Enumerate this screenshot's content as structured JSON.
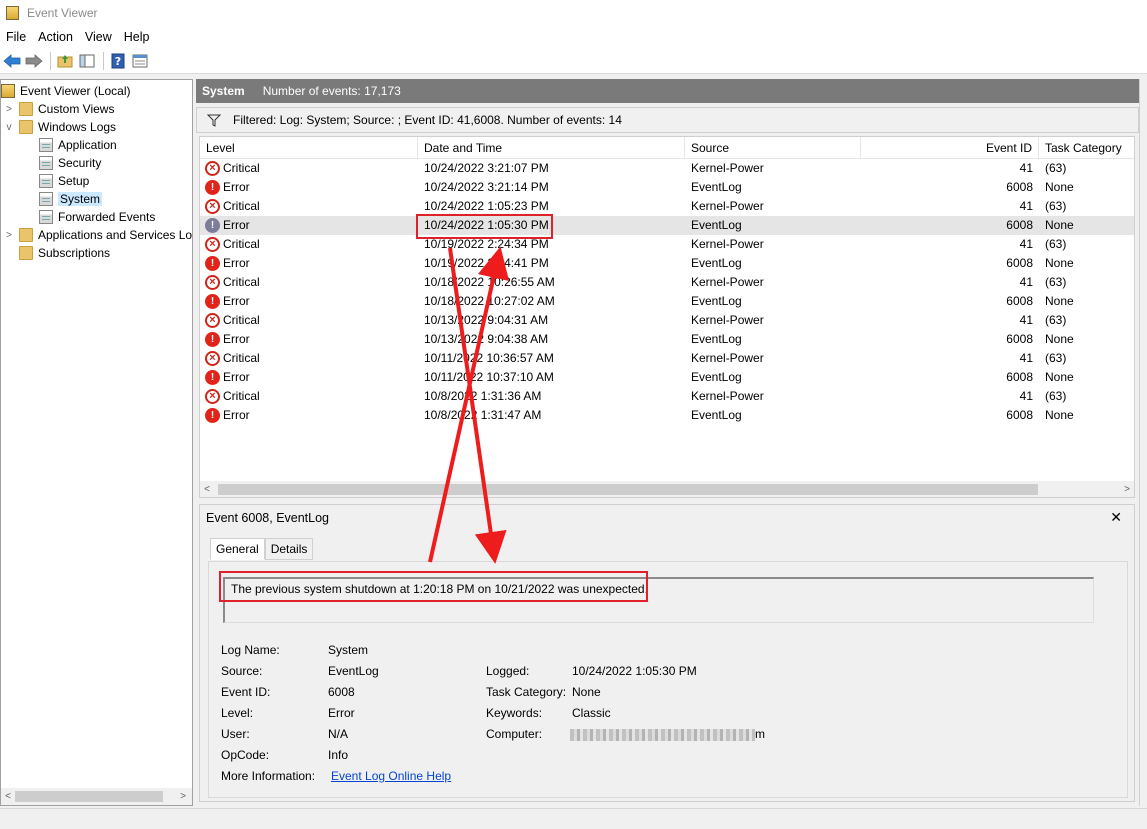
{
  "window": {
    "title": "Event Viewer"
  },
  "menu": [
    "File",
    "Action",
    "View",
    "Help"
  ],
  "toolbar": [
    "back-icon",
    "forward-icon",
    "up-folder-icon",
    "show-hide-tree-icon",
    "help-icon",
    "properties-icon"
  ],
  "tree": {
    "root": "Event Viewer (Local)",
    "custom_views": "Custom Views",
    "windows_logs": "Windows Logs",
    "logs": [
      "Application",
      "Security",
      "Setup",
      "System",
      "Forwarded Events"
    ],
    "apps_services": "Applications and Services Lo",
    "subscriptions": "Subscriptions"
  },
  "header": {
    "log_name": "System",
    "count_text": "Number of events: 17,173"
  },
  "filter": {
    "text": "Filtered: Log: System; Source: ; Event ID: 41,6008. Number of events: 14"
  },
  "columns": {
    "level": "Level",
    "datetime": "Date and Time",
    "source": "Source",
    "event_id": "Event ID",
    "task_category": "Task Category"
  },
  "events": [
    {
      "level": "Critical",
      "datetime": "10/24/2022 3:21:07 PM",
      "source": "Kernel-Power",
      "event_id": "41",
      "task": "(63)"
    },
    {
      "level": "Error",
      "datetime": "10/24/2022 3:21:14 PM",
      "source": "EventLog",
      "event_id": "6008",
      "task": "None"
    },
    {
      "level": "Critical",
      "datetime": "10/24/2022 1:05:23 PM",
      "source": "Kernel-Power",
      "event_id": "41",
      "task": "(63)"
    },
    {
      "level": "Error",
      "datetime": "10/24/2022 1:05:30 PM",
      "source": "EventLog",
      "event_id": "6008",
      "task": "None"
    },
    {
      "level": "Critical",
      "datetime": "10/19/2022 2:24:34 PM",
      "source": "Kernel-Power",
      "event_id": "41",
      "task": "(63)"
    },
    {
      "level": "Error",
      "datetime": "10/19/2022 2:24:41 PM",
      "source": "EventLog",
      "event_id": "6008",
      "task": "None"
    },
    {
      "level": "Critical",
      "datetime": "10/18/2022 10:26:55 AM",
      "source": "Kernel-Power",
      "event_id": "41",
      "task": "(63)"
    },
    {
      "level": "Error",
      "datetime": "10/18/2022 10:27:02 AM",
      "source": "EventLog",
      "event_id": "6008",
      "task": "None"
    },
    {
      "level": "Critical",
      "datetime": "10/13/2022 9:04:31 AM",
      "source": "Kernel-Power",
      "event_id": "41",
      "task": "(63)"
    },
    {
      "level": "Error",
      "datetime": "10/13/2022 9:04:38 AM",
      "source": "EventLog",
      "event_id": "6008",
      "task": "None"
    },
    {
      "level": "Critical",
      "datetime": "10/11/2022 10:36:57 AM",
      "source": "Kernel-Power",
      "event_id": "41",
      "task": "(63)"
    },
    {
      "level": "Error",
      "datetime": "10/11/2022 10:37:10 AM",
      "source": "EventLog",
      "event_id": "6008",
      "task": "None"
    },
    {
      "level": "Critical",
      "datetime": "10/8/2022 1:31:36 AM",
      "source": "Kernel-Power",
      "event_id": "41",
      "task": "(63)"
    },
    {
      "level": "Error",
      "datetime": "10/8/2022 1:31:47 AM",
      "source": "EventLog",
      "event_id": "6008",
      "task": "None"
    }
  ],
  "detail": {
    "title": "Event 6008, EventLog",
    "tabs": {
      "general": "General",
      "details": "Details"
    },
    "message": "The previous system shutdown at 1:20:18 PM on 10/21/2022 was unexpected.",
    "labels": {
      "log_name": "Log Name:",
      "source": "Source:",
      "event_id": "Event ID:",
      "level": "Level:",
      "user": "User:",
      "opcode": "OpCode:",
      "more_info": "More Information:",
      "logged": "Logged:",
      "task_category": "Task Category:",
      "keywords": "Keywords:",
      "computer": "Computer:"
    },
    "values": {
      "log_name": "System",
      "source": "EventLog",
      "event_id": "6008",
      "level": "Error",
      "user": "N/A",
      "opcode": "Info",
      "more_info_link": "Event Log Online Help",
      "logged": "10/24/2022 1:05:30 PM",
      "task_category": "None",
      "keywords": "Classic",
      "computer_suffix": "m"
    }
  }
}
